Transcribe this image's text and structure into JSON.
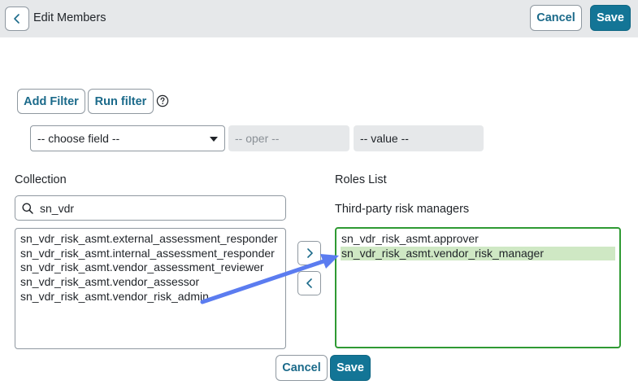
{
  "header": {
    "title": "Edit Members",
    "cancel_label": "Cancel",
    "save_label": "Save"
  },
  "filter": {
    "add_filter_label": "Add Filter",
    "run_filter_label": "Run filter",
    "field_select_value": "-- choose field --",
    "operator_placeholder": "-- oper --",
    "value_placeholder": "-- value --"
  },
  "collection": {
    "label": "Collection",
    "search_value": "sn_vdr",
    "items": [
      "sn_vdr_risk_asmt.external_assessment_responder",
      "sn_vdr_risk_asmt.internal_assessment_responder",
      "sn_vdr_risk_asmt.vendor_assessment_reviewer",
      "sn_vdr_risk_asmt.vendor_assessor",
      "sn_vdr_risk_asmt.vendor_risk_admin"
    ]
  },
  "roles": {
    "label": "Roles List",
    "group_title": "Third-party risk managers",
    "items": [
      "sn_vdr_risk_asmt.approver",
      "sn_vdr_risk_asmt.vendor_risk_manager"
    ],
    "selected_index": 1
  },
  "footer": {
    "cancel_label": "Cancel",
    "save_label": "Save"
  },
  "colors": {
    "accent": "#137596",
    "header_bg": "#e6e8ea",
    "roles_border": "#2f9a33",
    "selected_bg": "#cfe8c4",
    "annotation_arrow": "#5b7cf0"
  },
  "icons": {
    "back": "chevron-left-icon",
    "help": "question-circle-icon",
    "search": "search-icon",
    "add": "chevron-right-icon",
    "remove": "chevron-left-icon"
  }
}
